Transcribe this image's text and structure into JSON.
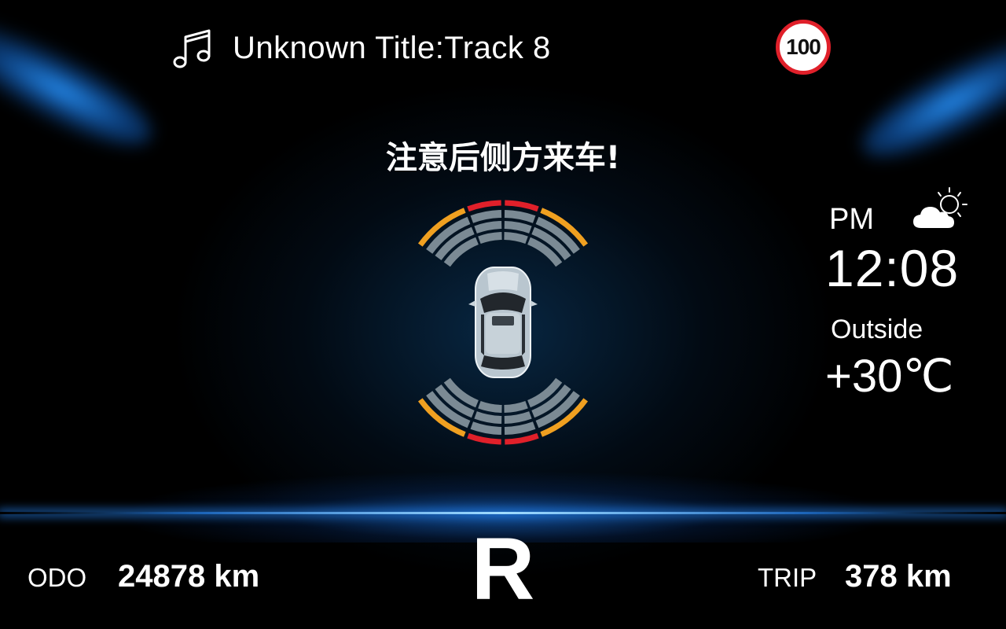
{
  "media": {
    "icon": "music-note-icon",
    "track_title": "Unknown Title:Track 8"
  },
  "speed_limit": {
    "value": "100",
    "ring_color": "#e0202a"
  },
  "warning": {
    "text": "注意后侧方来车!"
  },
  "radar": {
    "colors": {
      "inactive": "#7b8a94",
      "near": "#e0202a",
      "side": "#f0a020"
    },
    "front": {
      "outer_left": "side",
      "outer_center": "near",
      "outer_right": "side"
    },
    "rear": {
      "outer_left": "side",
      "outer_center": "near",
      "outer_right": "side"
    }
  },
  "clock": {
    "ampm": "PM",
    "time": "12:08"
  },
  "weather": {
    "icon": "partly-cloudy-icon"
  },
  "outside": {
    "label": "Outside",
    "temperature": "+30℃"
  },
  "odometer": {
    "label": "ODO",
    "value": "24878 km"
  },
  "gear": {
    "value": "R"
  },
  "trip": {
    "label": "TRIP",
    "value": "378 km"
  }
}
